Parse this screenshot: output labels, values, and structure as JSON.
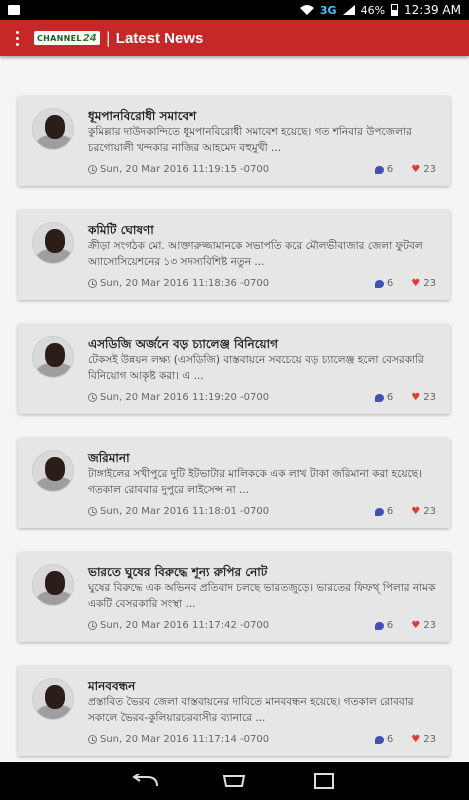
{
  "status_bar": {
    "network": "3G",
    "battery": "46%",
    "time": "12:39 AM"
  },
  "app_bar": {
    "logo_text": "CHANNEL",
    "logo_number": "24",
    "separator": "|",
    "title": "Latest News"
  },
  "articles": [
    {
      "title": "ধূমপানবিরোধী সমাবেশ",
      "summary": "কুমিল্লার দাউদকান্দিতে ধূমপানবিরোধী সমাবেশ হয়েছে। গত শনিবার উপজেলার চরগোয়ালী খন্দকার নাজির আহমেদ বহুমুখী ...",
      "date": "Sun, 20 Mar 2016 11:19:15 -0700",
      "comments": "6",
      "likes": "23"
    },
    {
      "title": "কমিটি ঘোষণা",
      "summary": "ক্রীড়া সংগঠক মো. আক্তারুজ্জামানকে সভাপতি করে মৌলভীবাজার জেলা ফুটবল অ্যাসোসিয়েশনের ১৩ সদস্যবিশিষ্ট নতুন ...",
      "date": "Sun, 20 Mar 2016 11:18:36 -0700",
      "comments": "6",
      "likes": "23"
    },
    {
      "title": "এসডিজি অর্জনে বড় চ্যালেঞ্জ বিনিয়োগ",
      "summary": "টেকসই উন্নয়ন লক্ষ্য (এসডিজি) বাস্তবায়নে সবচেয়ে বড় চ্যালেঞ্জ হলো বেসরকারি বিনিয়োগ আকৃষ্ট করা। এ ...",
      "date": "Sun, 20 Mar 2016 11:19:20 -0700",
      "comments": "6",
      "likes": "23"
    },
    {
      "title": "জরিমানা",
      "summary": "টাঙ্গাইলের সখীপুরে দুটি ইটভাটার মালিককে এক লাখ টাকা জরিমানা করা হয়েছে। গতকাল রোববার দুপুরে লাইসেন্স না ...",
      "date": "Sun, 20 Mar 2016 11:18:01 -0700",
      "comments": "6",
      "likes": "23"
    },
    {
      "title": "ভারতে ঘুষের বিরুদ্ধে শূন্য রুপির নোট",
      "summary": "ঘুষের বিরুদ্ধে এক অভিনব প্রতিবাদ চলছে ভারতজুড়ে। ভারতের ফিফথ্ পিলার নামক একটি বেসরকারি সংস্থা ...",
      "date": "Sun, 20 Mar 2016 11:17:42 -0700",
      "comments": "6",
      "likes": "23"
    },
    {
      "title": "মানববন্ধন",
      "summary": "প্রস্তাবিত ভৈরব জেলা বাস্তবায়নের দাবিতে মানববন্ধন হয়েছে। গতকাল রোববার সকালে ভৈরব-কুলিয়ারচরবাসীর ব্যানারে ...",
      "date": "Sun, 20 Mar 2016 11:17:14 -0700",
      "comments": "6",
      "likes": "23"
    }
  ],
  "nav_bar": {
    "back_icon": "back-arrow-icon",
    "home_icon": "home-icon",
    "recents_icon": "recents-icon"
  }
}
